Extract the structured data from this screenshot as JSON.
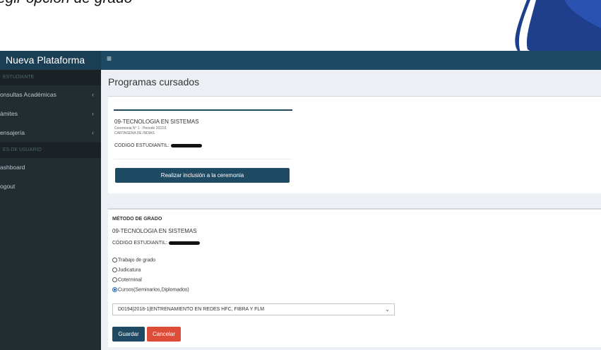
{
  "slide": {
    "title": "egir opción de grado"
  },
  "app": {
    "brand": "Nueva Plataforma",
    "menu_icon": "hamburger-icon",
    "colors": {
      "topbar": "#1e4a63",
      "sidebar": "#222d32",
      "primary": "#1e4a63",
      "danger": "#dd4b39"
    }
  },
  "sidebar": {
    "header1": "ESTUDIANTE",
    "items": [
      {
        "label": "onsultas Académicas",
        "chevron": "‹"
      },
      {
        "label": "ámites",
        "chevron": "‹"
      },
      {
        "label": "ensajería",
        "chevron": "‹"
      }
    ],
    "header2": "ES DE USUARIO",
    "items2": [
      {
        "label": "ashboard"
      },
      {
        "label": "ogout"
      }
    ]
  },
  "page": {
    "title": "Programas cursados"
  },
  "program_card": {
    "program": "09-TECNOLOGIA EN SISTEMAS",
    "ceremony": "Ceremonia N° 1 - Periodo 2022/1",
    "city": "CARTAGENA DE INDIAS",
    "student_code_label": "CODIGO ESTUDIANTIL:",
    "button": "Realizar inclusión a la ceremonia"
  },
  "grade_method": {
    "heading": "MÉTODO DE GRADO",
    "program": "09-TECNOLOGIA EN SISTEMAS",
    "student_code_label": "CÓDIGO ESTUDIANTIL:",
    "options": [
      {
        "label": "Trabajo de grado",
        "selected": false
      },
      {
        "label": "Judicatura",
        "selected": false
      },
      {
        "label": "Coterminal",
        "selected": false
      },
      {
        "label": "Cursos(Seminarios,Diplomados)",
        "selected": true
      }
    ],
    "course_select": "D0194|2018-1|ENTRENAMIENTO EN REDES HFC, FIBRA Y FLM",
    "save_label": "Guardar",
    "cancel_label": "Cancelar"
  }
}
